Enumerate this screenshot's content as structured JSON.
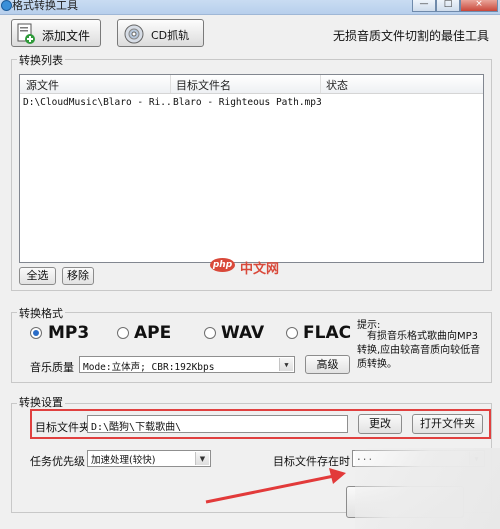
{
  "window": {
    "title": "格式转换工具",
    "controls": [
      "—",
      "□",
      "×"
    ]
  },
  "toolbar": {
    "add_file_label": "添加文件",
    "cd_rip_label": "CD抓轨",
    "slogan": "无损音质文件切割的最佳工具"
  },
  "convert_list": {
    "group_label": "转换列表",
    "columns": [
      "源文件",
      "目标文件名",
      "状态"
    ],
    "rows": [
      {
        "source": "D:\\CloudMusic\\Blaro - Ri..",
        "target": "Blaro - Righteous Path.mp3",
        "status": ""
      }
    ],
    "select_all_label": "全选",
    "remove_label": "移除"
  },
  "watermark": {
    "logo": "php",
    "text": "中文网"
  },
  "format": {
    "group_label": "转换格式",
    "options": [
      "MP3",
      "APE",
      "WAV",
      "FLAC"
    ],
    "selected": "MP3",
    "quality_label": "音乐质量",
    "quality_value": "Mode:立体声; CBR:192Kbps",
    "advanced_label": "高级",
    "tip_title": "提示:",
    "tip_text": "有损音乐格式歌曲向MP3转换,应由较高音质向较低音质转换。"
  },
  "settings": {
    "group_label": "转换设置",
    "target_folder_label": "目标文件夹",
    "target_folder_value": "D:\\酷狗\\下载歌曲\\",
    "change_label": "更改",
    "open_folder_label": "打开文件夹",
    "priority_label": "任务优先级",
    "priority_value": "加速处理(较快)",
    "exists_label": "目标文件存在时",
    "exists_value": "..."
  },
  "colors": {
    "highlight_box": "#e0403f",
    "arrow": "#e23a3a",
    "radio_selected": "#2a6cc7"
  }
}
